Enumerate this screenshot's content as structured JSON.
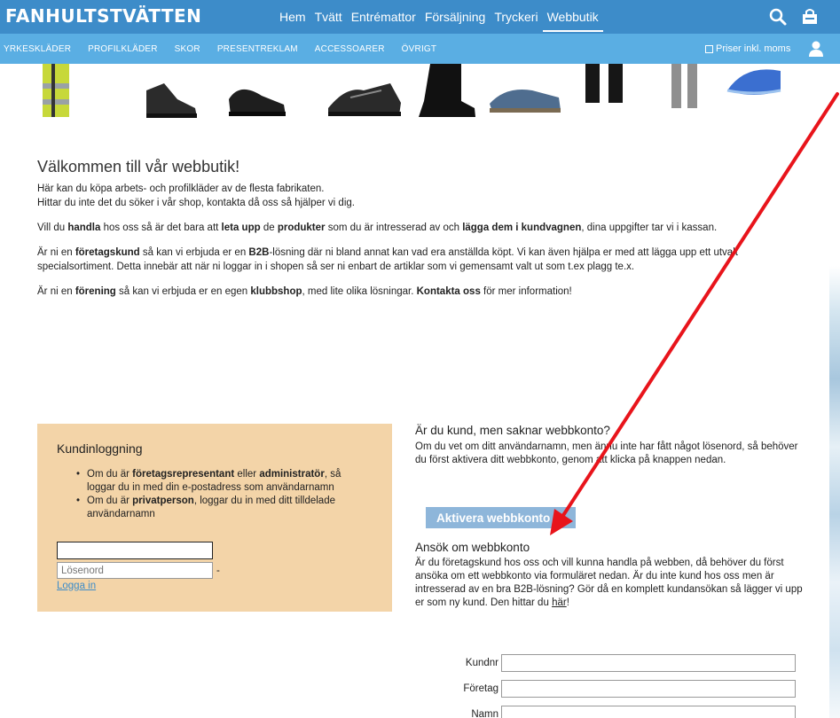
{
  "header": {
    "logo": "FANHULTSTVÄTTEN",
    "nav": [
      "Hem",
      "Tvätt",
      "Entrémattor",
      "Försäljning",
      "Tryckeri",
      "Webbutik"
    ],
    "active_nav": "Webbutik",
    "icons": [
      "search-icon",
      "cart-icon"
    ]
  },
  "subnav": {
    "items": [
      "YRKESKLÄDER",
      "PROFILKLÄDER",
      "SKOR",
      "PRESENTREKLAM",
      "ACCESSOARER",
      "ÖVRIGT"
    ],
    "vat_label": "Priser inkl. moms",
    "user_icon": "user-icon"
  },
  "welcome": {
    "title": "Välkommen till vår webbutik!",
    "intro1": "Här kan du köpa arbets- och profilkläder av de flesta fabrikaten.",
    "intro2": "Hittar du inte det du söker i vår shop, kontakta då oss så hjälper vi dig.",
    "p2": [
      "Vill du ",
      "handla",
      " hos oss så är det bara att ",
      "leta upp",
      " de ",
      "produkter",
      " som du är intresserad av och ",
      "lägga dem i kundvagnen",
      ", dina uppgifter tar vi i kassan."
    ],
    "p3": [
      "Är ni en ",
      "företagskund",
      " så kan vi erbjuda er en ",
      "B2B",
      "-lösning där ni bland annat kan vad era anställda köpt. Vi kan även hjälpa er med att lägga upp ett utvalt specialsortiment. Detta innebär att när ni loggar in i shopen så ser ni enbart de artiklar som vi gemensamt valt ut som t.ex plagg te.x."
    ],
    "p4": [
      "Är ni en ",
      "förening",
      " så kan vi erbjuda er en egen ",
      "klubbshop",
      ", med lite olika lösningar. ",
      "Kontakta oss",
      " för mer information!"
    ]
  },
  "login": {
    "title": "Kundinloggning",
    "b1": [
      "Om du är ",
      "företagsrepresentant",
      " eller ",
      "administratör",
      ", så loggar du in med din e-postadress som användarnamn"
    ],
    "b2": [
      "Om du är ",
      "privatperson",
      ", loggar du in med ditt tilldelade användarnamn"
    ],
    "username_value": "",
    "password_placeholder": "Lösenord",
    "dash": "-",
    "login_link": "Logga in"
  },
  "account": {
    "title": "Är du kund, men saknar webbkonto?",
    "text": "Om du vet om ditt användarnamn, men ännu inte har fått något lösenord, så behöver du först aktivera ditt webbkonto, genom att klicka på knappen nedan.",
    "activate_button": "Aktivera webbkonto"
  },
  "apply": {
    "title": "Ansök om webbkonto",
    "text": "Är du företagskund hos oss och vill kunna handla på webben, då behöver du först ansöka om ett webbkonto via formuläret nedan. Är du inte kund hos oss men är intresserad av en bra B2B-lösning? Gör då en komplett kundansökan så lägger vi upp er som ny kund. Den hittar du ",
    "link": "här",
    "after": "!",
    "fields": [
      "Kundnr",
      "Företag",
      "Namn"
    ]
  },
  "colors": {
    "topbar": "#3d8cc9",
    "subbar": "#5aaee3",
    "login_bg": "#f3d4a8",
    "button": "#8eb6da",
    "arrow": "#e8141b"
  }
}
